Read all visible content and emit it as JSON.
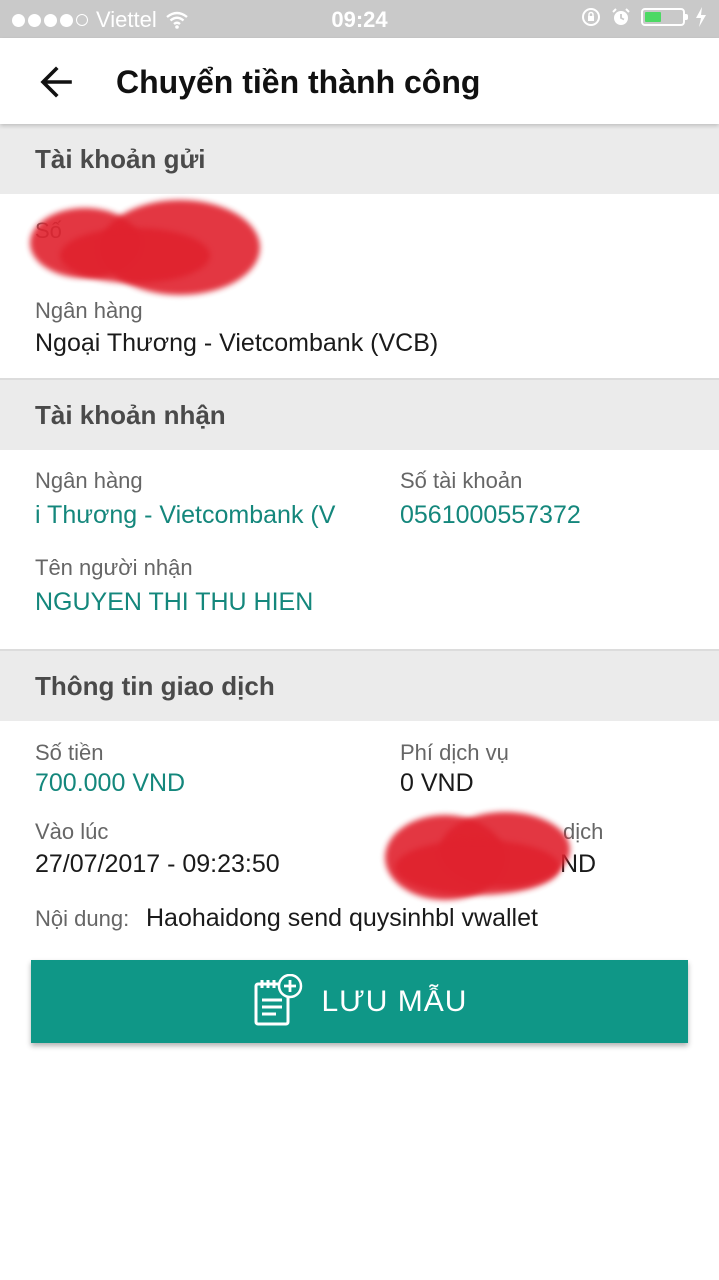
{
  "status_bar": {
    "carrier": "Viettel",
    "time": "09:24",
    "battery_level": 0.45,
    "battery_color": "#4cd964"
  },
  "header": {
    "title": "Chuyển tiền thành công",
    "back_icon": "arrow-left-icon"
  },
  "sender": {
    "section_title": "Tài khoản gửi",
    "account_label": "Số",
    "bank_label": "Ngân hàng",
    "bank_value": "Ngoại Thương - Vietcombank (VCB)"
  },
  "receiver": {
    "section_title": "Tài khoản nhận",
    "bank_label": "Ngân hàng",
    "bank_value": "i Thương - Vietcombank (V",
    "account_label": "Số tài khoản",
    "account_value": "0561000557372",
    "name_label": "Tên người nhận",
    "name_value": "NGUYEN THI THU HIEN"
  },
  "transaction": {
    "section_title": "Thông tin giao dịch",
    "amount_label": "Số tiền",
    "amount_value": "700.000 VND",
    "fee_label": "Phí dịch vụ",
    "fee_value": "0 VND",
    "time_label": "Vào lúc",
    "time_value": "27/07/2017 - 09:23:50",
    "code_label_partial": "dịch",
    "code_value_partial": "ND",
    "content_label": "Nội dung:",
    "content_value": "Haohaidong send quysinhbl vwallet"
  },
  "save_button": {
    "label": "LƯU MẪU",
    "icon": "note-add-icon"
  },
  "colors": {
    "accent": "#0f9787",
    "teal_text": "#14877c",
    "section_bg": "#ebebeb"
  }
}
